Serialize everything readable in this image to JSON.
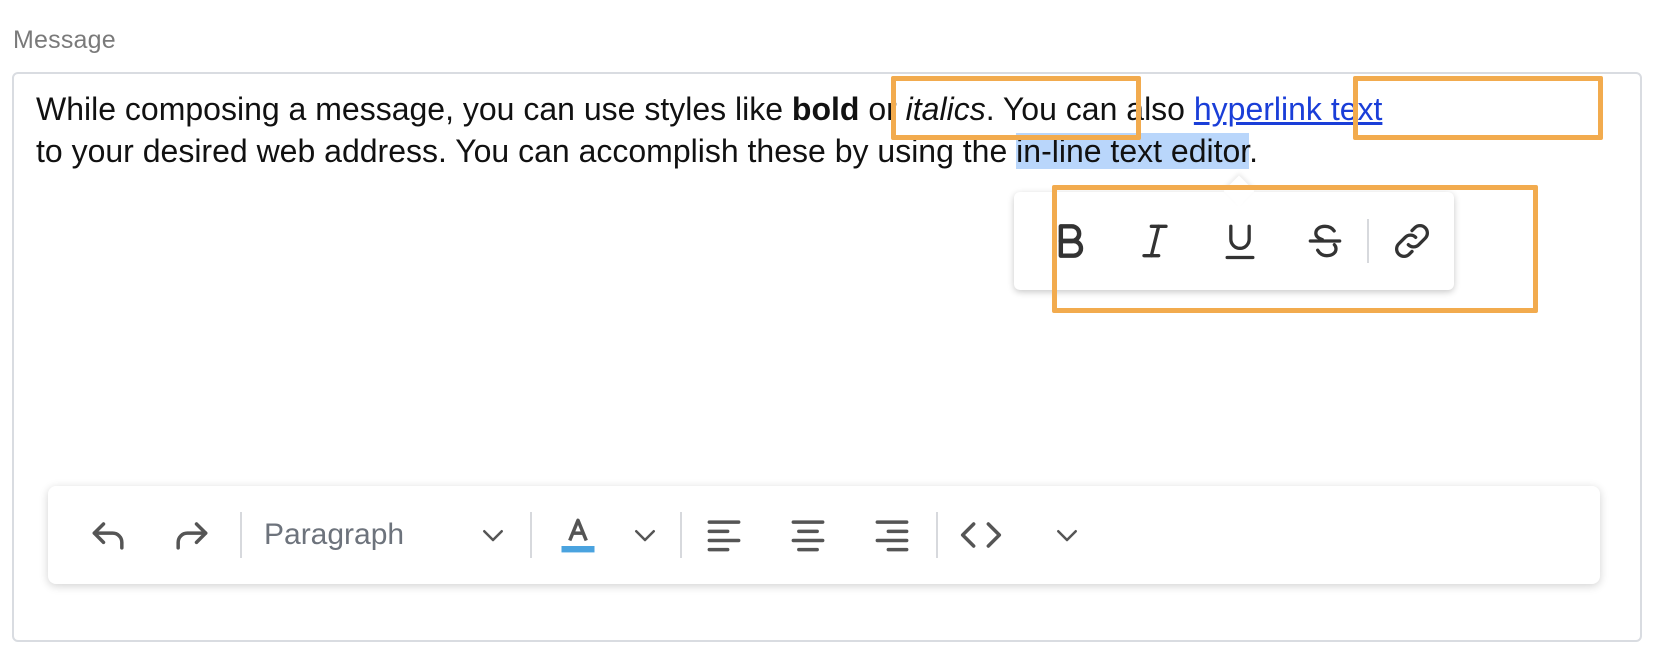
{
  "field": {
    "label": "Message"
  },
  "message": {
    "text_1": "While composing a message, you can use styles like ",
    "bold_word": "bold",
    "text_or": " or ",
    "italic_word": "italics",
    "text_2": ". You can also ",
    "link_text": "hyperlink text",
    "text_3": "to your desired web address. You can accomplish these by using the ",
    "selected_text": "in-line text editor",
    "text_4": "."
  },
  "inline_toolbar": {
    "buttons": [
      "bold-icon",
      "italic-icon",
      "underline-icon",
      "strikethrough-icon",
      "link-icon"
    ]
  },
  "toolbar": {
    "block_format": "Paragraph",
    "text_color_swatch": "#4aa3df",
    "icons": [
      "undo-icon",
      "redo-icon",
      "chevron-down-icon",
      "text-color-icon",
      "chevron-down-icon",
      "align-left-icon",
      "align-center-icon",
      "align-right-icon",
      "code-icon",
      "chevron-down-icon"
    ]
  },
  "colors": {
    "highlight_border": "#f2ab4e",
    "selection": "#b9d6fb",
    "link": "#1a3ed8"
  }
}
